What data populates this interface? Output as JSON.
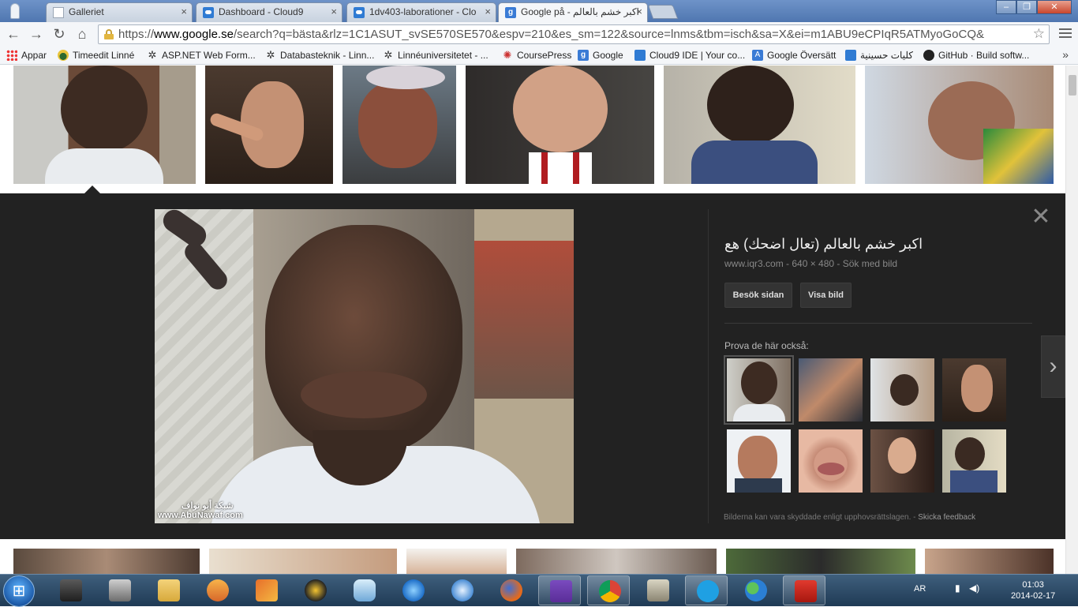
{
  "tabs": [
    {
      "label": "Galleriet",
      "icon": "document-icon",
      "active": false
    },
    {
      "label": "Dashboard - Cloud9",
      "icon": "cloud9-icon",
      "active": false
    },
    {
      "label": "1dv403-laborationer - Clo",
      "icon": "cloud9-icon",
      "active": false
    },
    {
      "label": "اكبر خشم بالعالم - Google på",
      "icon": "google-icon",
      "active": true
    }
  ],
  "window_controls": {
    "minimize": "–",
    "maximize": "❐",
    "close": "✕"
  },
  "toolbar": {
    "back": "←",
    "forward": "→",
    "reload": "↻",
    "home": "⌂",
    "url_prefix": "https://",
    "url_host": "www.google.se",
    "url_rest": "/search?q=bästa&rlz=1C1ASUT_svSE570SE570&espv=210&es_sm=122&source=lnms&tbm=isch&sa=X&ei=m1ABU9eCPIqR5ATMyoGoCQ&",
    "star": "☆"
  },
  "bookmarks": [
    {
      "label": "Appar",
      "icon": "apps-icon"
    },
    {
      "label": "Timeedit Linné",
      "icon": "timeedit-icon"
    },
    {
      "label": "ASP.NET Web Form...",
      "icon": "tree-icon"
    },
    {
      "label": "Databasteknik - Linn...",
      "icon": "tree-icon"
    },
    {
      "label": "Linnéuniversitetet - ...",
      "icon": "tree-icon"
    },
    {
      "label": "CoursePress",
      "icon": "coursepress-icon"
    },
    {
      "label": "Google",
      "icon": "google-icon"
    },
    {
      "label": "Cloud9 IDE | Your co...",
      "icon": "cloud9-icon"
    },
    {
      "label": "Google Översätt",
      "icon": "translate-icon"
    },
    {
      "label": "كليات حسينية",
      "icon": "cloud9-icon"
    },
    {
      "label": "GitHub · Build softw...",
      "icon": "github-icon"
    }
  ],
  "bookmarks_more": "»",
  "detail": {
    "title": "اكبر خشم بالعالم (تعال اضحك) هع",
    "meta": "www.iqr3.com - 640 × 480 - Sök med bild",
    "visit_button": "Besök sidan",
    "view_button": "Visa bild",
    "related_label": "Prova de här också:",
    "close": "✕",
    "next": "›",
    "footnote": "Bilderna kan vara skyddade enligt upphovsrättslagen.",
    "feedback": "Skicka feedback",
    "watermark_line1": "شبكة أبو نواف",
    "watermark_line2": "www.AbuNawaf.com"
  },
  "colors": {
    "panel_bg": "#222222",
    "tabstrip": "#5a80b8",
    "taskbar": "#2b4864"
  },
  "taskbar": {
    "items": [
      {
        "name": "winamp-icon",
        "open": false
      },
      {
        "name": "game-icon",
        "open": false
      },
      {
        "name": "explorer-icon",
        "open": false
      },
      {
        "name": "media-player-icon",
        "open": false
      },
      {
        "name": "paint-icon",
        "open": false
      },
      {
        "name": "snagit-icon",
        "open": false
      },
      {
        "name": "generic-app-icon",
        "open": false
      },
      {
        "name": "internet-explorer-icon",
        "open": false
      },
      {
        "name": "safari-icon",
        "open": false
      },
      {
        "name": "firefox-icon",
        "open": false
      },
      {
        "name": "visual-studio-icon",
        "open": true
      },
      {
        "name": "chrome-icon",
        "open": true
      },
      {
        "name": "tools-icon",
        "open": false
      },
      {
        "name": "skype-icon",
        "open": true
      },
      {
        "name": "messenger-icon",
        "open": false
      },
      {
        "name": "pdf-icon",
        "open": true
      }
    ],
    "lang": "AR",
    "time": "01:03",
    "date": "2014-02-17"
  }
}
